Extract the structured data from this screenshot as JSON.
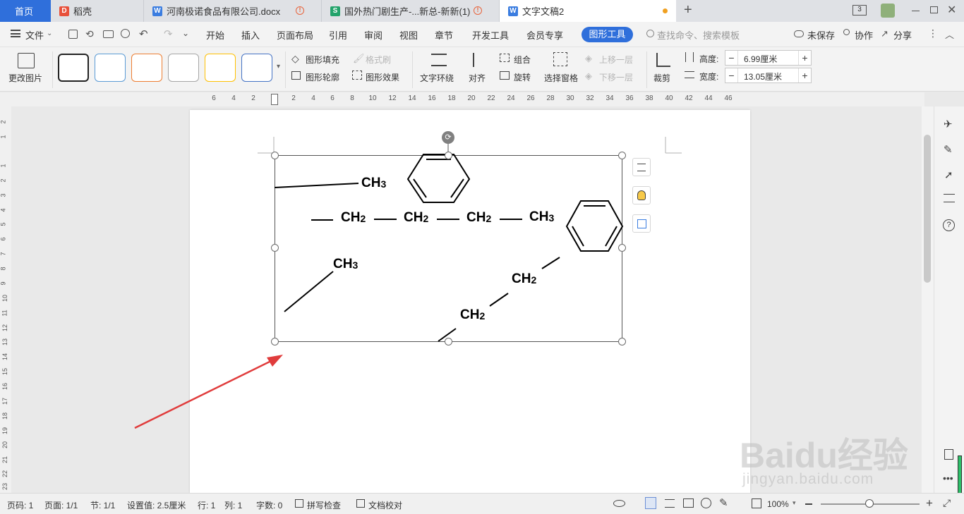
{
  "tabs": [
    {
      "label": "首页",
      "active_home": true
    },
    {
      "label": "稻壳"
    },
    {
      "label": "河南极诺食品有限公司.docx"
    },
    {
      "label": "国外热门剧生产-...新总-新新(1)"
    },
    {
      "label": "文字文稿2"
    }
  ],
  "titlebar": {
    "doc_count": "3",
    "new_tab": "+"
  },
  "menubar": {
    "file": "文件",
    "items": [
      "开始",
      "插入",
      "页面布局",
      "引用",
      "审阅",
      "视图",
      "章节",
      "开发工具",
      "会员专享"
    ],
    "active_tool": "图形工具",
    "search_placeholder": "查找命令、搜索模板",
    "unsaved": "未保存",
    "collab": "协作",
    "share": "分享"
  },
  "ribbon": {
    "change_image": "更改图片",
    "shape_fill": "图形填充",
    "format_brush": "格式刷",
    "shape_outline": "图形轮廓",
    "shape_effect": "图形效果",
    "text_wrap": "文字环绕",
    "align": "对齐",
    "group": "组合",
    "rotate": "旋转",
    "selection_pane": "选择窗格",
    "bring_forward": "上移一层",
    "send_backward": "下移一层",
    "crop": "裁剪",
    "height_label": "高度:",
    "height_value": "6.99厘米",
    "width_label": "宽度:",
    "width_value": "13.05厘米",
    "swatch_colors": [
      "#222222",
      "#5b9bd5",
      "#ed7d31",
      "#a5a5a5",
      "#ffc000",
      "#4472c4"
    ]
  },
  "ruler": {
    "h_ticks": [
      "6",
      "4",
      "2",
      "2",
      "4",
      "6",
      "8",
      "10",
      "12",
      "14",
      "16",
      "18",
      "20",
      "22",
      "24",
      "26",
      "28",
      "30",
      "32",
      "34",
      "36",
      "38",
      "40",
      "42",
      "44",
      "46"
    ],
    "v_ticks": [
      "2",
      "1",
      "1",
      "2",
      "3",
      "4",
      "5",
      "6",
      "7",
      "8",
      "9",
      "10",
      "11",
      "12",
      "13",
      "14",
      "15",
      "16",
      "17",
      "18",
      "19",
      "20",
      "21",
      "22",
      "23"
    ]
  },
  "drawing": {
    "labels": {
      "ch3_top": "CH",
      "ch3_top_sub": "3",
      "ch2_a": "CH",
      "ch2_a_sub": "2",
      "ch2_b": "CH",
      "ch2_b_sub": "2",
      "ch2_c": "CH",
      "ch2_c_sub": "2",
      "ch3_right": "CH",
      "ch3_right_sub": "3",
      "ch3_left": "CH",
      "ch3_left_sub": "3",
      "ch2_d": "CH",
      "ch2_d_sub": "2",
      "ch2_e": "CH",
      "ch2_e_sub": "2"
    }
  },
  "watermark": {
    "brand": "Baidu经验",
    "url": "jingyan.baidu.com"
  },
  "status": {
    "page_code": "页码: 1",
    "pages": "页面: 1/1",
    "section": "节: 1/1",
    "setting": "设置值: 2.5厘米",
    "row": "行: 1",
    "col": "列: 1",
    "word_count": "字数: 0",
    "spell_check": "拼写检查",
    "doc_proof": "文档校对",
    "zoom": "100%"
  }
}
